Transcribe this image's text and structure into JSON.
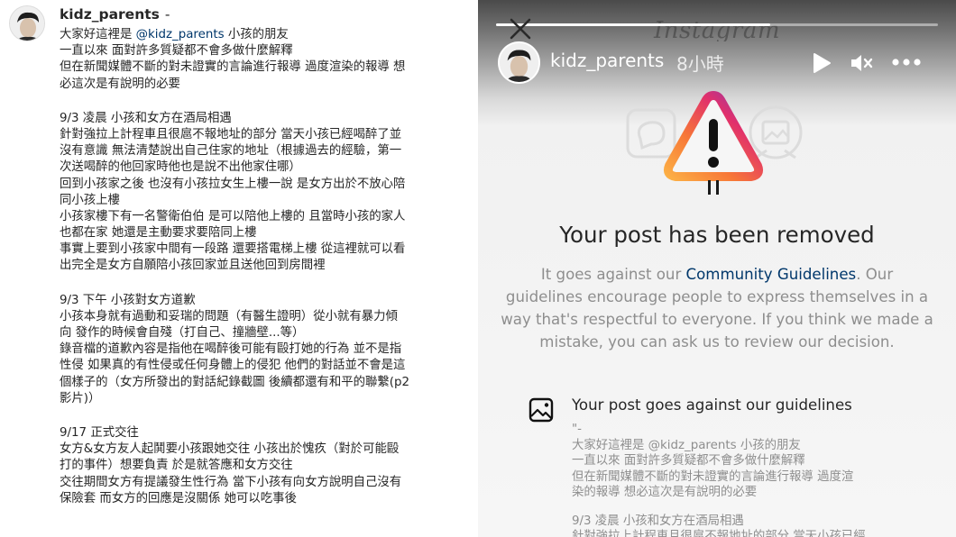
{
  "post": {
    "username": "kidz_parents",
    "dash": "-",
    "caption_lines": [
      {
        "before": "大家好這裡是 ",
        "mention": "@kidz_parents",
        "after": " 小孩的朋友"
      },
      {
        "text": "一直以來 面對許多質疑都不會多做什麼解釋"
      },
      {
        "text": "但在新聞媒體不斷的對未證實的言論進行報導 過度渲染的報導 想"
      },
      {
        "text": "必這次是有說明的必要"
      },
      {
        "blank": true
      },
      {
        "text": "9/3 凌晨 小孩和女方在酒局相遇"
      },
      {
        "text": "針對強拉上計程車且很扈不報地址的部分 當天小孩已經喝醉了並"
      },
      {
        "text": "沒有意識 無法清楚說出自己住家的地址（根據過去的經驗，第一"
      },
      {
        "text": "次送喝醉的他回家時他也是說不出他家住哪）"
      },
      {
        "text": "回到小孩家之後 也沒有小孩拉女生上樓一說 是女方出於不放心陪"
      },
      {
        "text": "同小孩上樓"
      },
      {
        "text": "小孩家樓下有一名警衛伯伯 是可以陪他上樓的 且當時小孩的家人"
      },
      {
        "text": "也都在家 她還是主動要求要陪同上樓"
      },
      {
        "text": "事實上要到小孩家中間有一段路 還要搭電梯上樓 從這裡就可以看"
      },
      {
        "text": "出完全是女方自願陪小孩回家並且送他回到房間裡"
      },
      {
        "blank": true
      },
      {
        "text": "9/3 下午 小孩對女方道歉"
      },
      {
        "text": "小孩本身就有過動和妥瑞的問題（有醫生證明）從小就有暴力傾"
      },
      {
        "text": "向 發作的時候會自殘（打自己、撞牆壁...等）"
      },
      {
        "text": "錄音檔的道歉內容是指他在喝醉後可能有毆打她的行為 並不是指"
      },
      {
        "text": "性侵 如果真的有性侵或任何身體上的侵犯 他們的對話並不會是這"
      },
      {
        "text": "個樣子的（女方所發出的對話紀錄截圖 後續都還有和平的聯繫(p2"
      },
      {
        "text": "影片)）"
      },
      {
        "blank": true
      },
      {
        "text": "9/17 正式交往"
      },
      {
        "text": "女方&女方友人起鬨要小孩跟她交往 小孩出於愧疚（對於可能毆"
      },
      {
        "text": "打的事件）想要負責 於是就答應和女方交往"
      },
      {
        "text": "交往期間女方有提議發生性行為 當下小孩有向女方說明自己沒有"
      },
      {
        "text": "保險套 而女方的回應是沒關係 她可以吃事後"
      }
    ]
  },
  "story": {
    "wordmark": "Instagram",
    "username": "kidz_parents",
    "time": "8小時",
    "progress": 0.62,
    "notice": {
      "title": "Your post has been removed",
      "body_before": "It goes against our ",
      "link": "Community Guidelines",
      "body_after": ". Our guidelines encourage people to express themselves in a way that's respectful to everyone. If you think we made a mistake, you can ask us to review our decision."
    },
    "reason": {
      "title": "Your post goes against our guidelines",
      "quote_lines": [
        {
          "text": "\"-"
        },
        {
          "text": "大家好這裡是 @kidz_parents 小孩的朋友"
        },
        {
          "text": "一直以來 面對許多質疑都不會多做什麼解釋"
        },
        {
          "text": "但在新聞媒體不斷的對未證實的言論進行報導 過度渲"
        },
        {
          "text": "染的報導 想必這次是有說明的必要"
        },
        {
          "blank": true
        },
        {
          "text": "9/3 凌晨 小孩和女方在酒局相遇"
        },
        {
          "text": "針對強拉上計程車且很扈不報地址的部分 當天小孩已經"
        }
      ]
    },
    "icons": [
      "close-icon",
      "play-icon",
      "mute-icon",
      "more-icon",
      "comment-icon",
      "image-icon",
      "warning-icon",
      "image-icon"
    ]
  },
  "colors": {
    "link": "#00376b",
    "warning_gradient": [
      "#fcaf45",
      "#f77737",
      "#e1306c",
      "#833ab4"
    ]
  }
}
